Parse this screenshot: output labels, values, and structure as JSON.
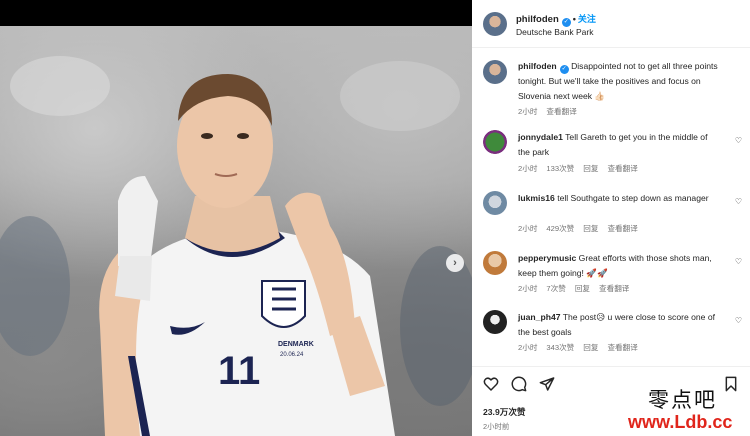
{
  "post": {
    "username": "philfoden",
    "follow_label": "关注",
    "location": "Deutsche Bank Park",
    "caption_user": "philfoden",
    "caption_text": "Disappointed not to get all three points tonight. But we'll take the positives and focus on Slovenia next week 👍🏻",
    "caption_time": "2小时",
    "caption_translate": "查看翻译"
  },
  "photo": {
    "shirt_text": "DENMARK",
    "shirt_date": "20.06.24",
    "shirt_number": "11"
  },
  "comments": [
    {
      "user": "jonnydale1",
      "text": "Tell Gareth to get you in the middle of the park",
      "time": "2小时",
      "likes": "133次赞",
      "reply": "回复",
      "translate": "查看翻译"
    },
    {
      "user": "lukmis16",
      "text": "tell Southgate to step down as manager",
      "time": "2小时",
      "likes": "429次赞",
      "reply": "回复",
      "translate": "查看翻译"
    },
    {
      "user": "pepperymusic",
      "text": "Great efforts with those shots man, keep them going! 🚀🚀",
      "time": "2小时",
      "likes": "7次赞",
      "reply": "回复",
      "translate": "查看翻译"
    },
    {
      "user": "juan_ph47",
      "text": "The post😥 u were close to score one of the best goals",
      "time": "2小时",
      "likes": "343次赞",
      "reply": "回复",
      "translate": "查看翻译"
    }
  ],
  "footer": {
    "likes": "23.9万次赞",
    "time": "2小时前"
  },
  "watermark": {
    "cn": "零点吧",
    "url": "www.Ldb.cc"
  },
  "icons": [
    "verified-badge-icon",
    "next-arrow-icon",
    "heart-icon",
    "comment-icon",
    "share-icon",
    "bookmark-icon"
  ],
  "colors": {
    "link_blue": "#0095f6",
    "verified_blue": "#1e8ef0",
    "watermark_red": "#e0251b"
  }
}
